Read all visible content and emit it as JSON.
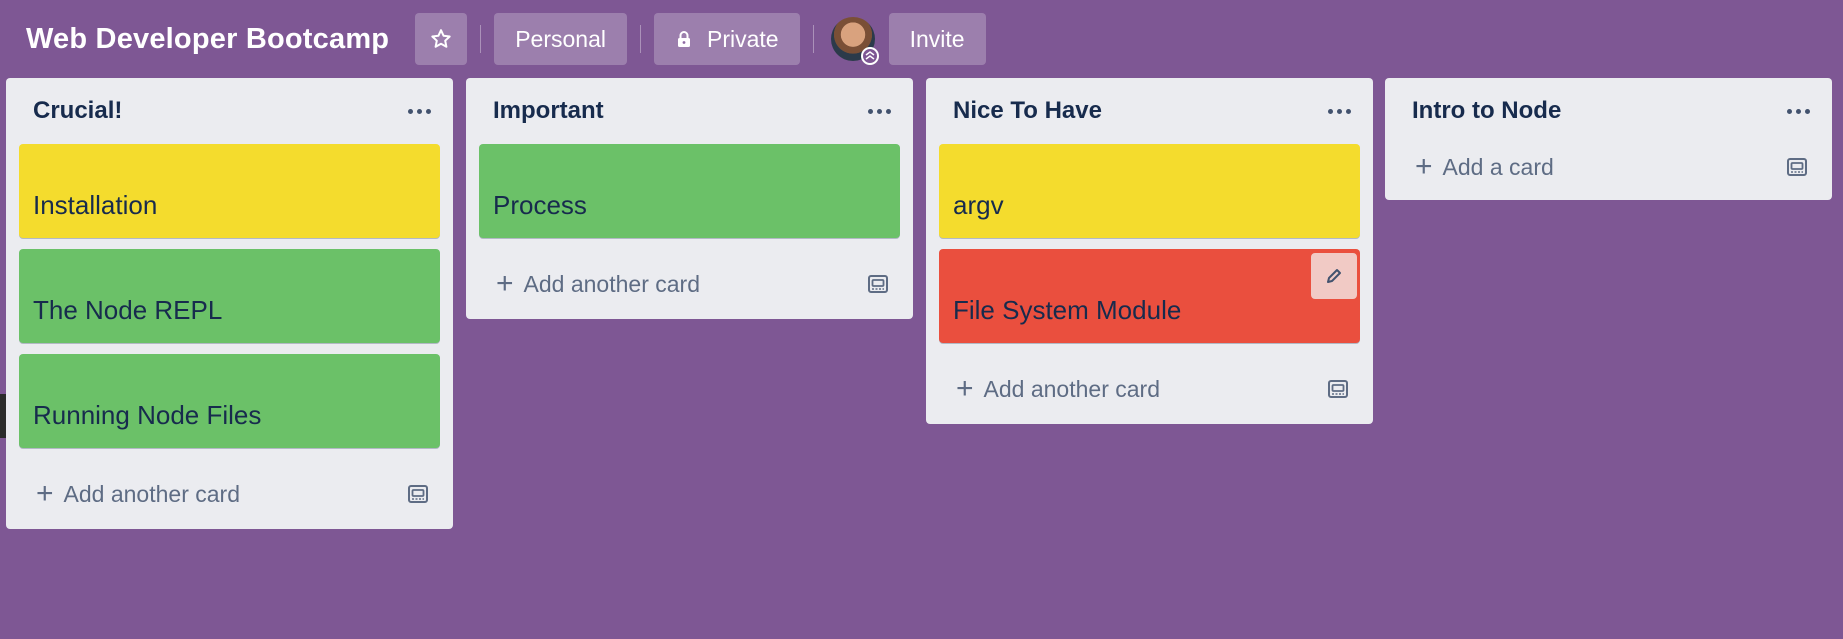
{
  "header": {
    "board_title": "Web Developer Bootcamp",
    "personal_label": "Personal",
    "private_label": "Private",
    "invite_label": "Invite"
  },
  "lists": [
    {
      "title": "Crucial!",
      "cards": [
        {
          "title": "Installation",
          "color": "#f4dc2d"
        },
        {
          "title": "The Node REPL",
          "color": "#6bc168"
        },
        {
          "title": "Running Node Files",
          "color": "#6bc168"
        }
      ],
      "add_label": "Add another card"
    },
    {
      "title": "Important",
      "cards": [
        {
          "title": "Process",
          "color": "#6bc168"
        }
      ],
      "add_label": "Add another card"
    },
    {
      "title": "Nice To Have",
      "cards": [
        {
          "title": "argv",
          "color": "#f4dc2d"
        },
        {
          "title": "File System Module",
          "color": "#ea4f3e"
        }
      ],
      "add_label": "Add another card"
    },
    {
      "title": "Intro to Node",
      "cards": [],
      "add_label": "Add a card"
    }
  ],
  "colors": {
    "board_background": "#7e5794",
    "list_background": "#ebecf0",
    "label_yellow": "#f4dc2d",
    "label_green": "#6bc168",
    "label_red": "#ea4f3e"
  },
  "icons": [
    "star-icon",
    "lock-icon",
    "avatar",
    "list-menu-icon",
    "plus-icon",
    "template-icon",
    "pencil-icon",
    "chevron-left-icon"
  ]
}
